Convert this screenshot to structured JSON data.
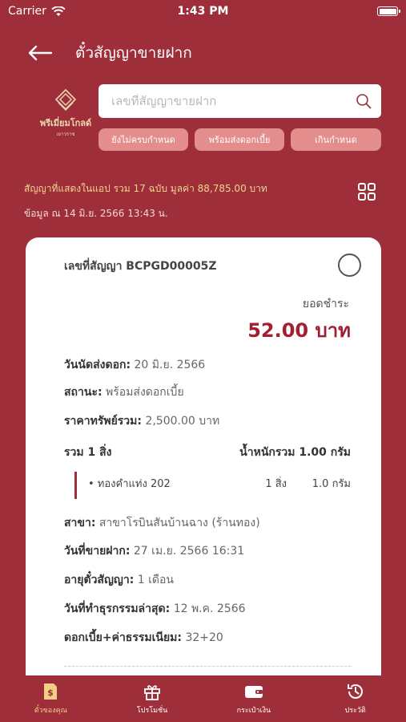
{
  "status_bar": {
    "carrier": "Carrier",
    "time": "1:43 PM"
  },
  "nav": {
    "title": "ตั๋วสัญญาขายฝาก"
  },
  "logo": {
    "name": "พรีเมี่ยมโกลด์",
    "sub": "เยาวราช"
  },
  "search": {
    "placeholder": "เลขที่สัญญาขายฝาก",
    "value": ""
  },
  "filters": [
    "ยังไม่ครบกำหนด",
    "พร้อมส่งดอกเบี้ย",
    "เกินกำหนด"
  ],
  "summary": {
    "text": "สัญญาที่แสดงในแอป รวม 17 ฉบับ มูลค่า 88,785.00 บาท",
    "updated": "ข้อมูล ณ 14 มิ.ย. 2566 13:43  น."
  },
  "card": {
    "contract_no": "เลขที่สัญญา BCPGD00005Z",
    "amount_label": "ยอดชำระ",
    "amount": "52.00 บาท",
    "due_label": "วันนัดส่งดอก:",
    "due_value": "20 มิ.ย. 2566",
    "status_label": "สถานะ:",
    "status_value": "พร้อมส่งดอกเบี้ย",
    "asset_label": "ราคาทรัพย์รวม:",
    "asset_value": "2,500.00 บาท",
    "items_total": "รวม 1 สิ่ง",
    "weight_total": "น้ำหนักรวม 1.00 กรัม",
    "items": [
      {
        "name": "• ทองคำแท่ง 202",
        "qty": "1 สิ่ง",
        "weight": "1.0 กรัม"
      }
    ],
    "branch_label": "สาขา:",
    "branch_value": "สาขาโรบินสันบ้านฉาง (ร้านทอง)",
    "sold_label": "วันที่ขายฝาก:",
    "sold_value": "27 เม.ย. 2566 16:31",
    "term_label": "อายุตั๋วสัญญา:",
    "term_value": "1 เดือน",
    "last_txn_label": "วันที่ทำธุรกรรมล่าสุด:",
    "last_txn_value": "12 พ.ค. 2566",
    "fee_label": "ดอกเบี้ย+ค่าธรรมเนียม:",
    "fee_value": "32+20"
  },
  "tabs": [
    {
      "label": "ตั๋วของคุณ",
      "icon": "ticket-icon",
      "active": true
    },
    {
      "label": "โปรโมชั่น",
      "icon": "gift-icon",
      "active": false
    },
    {
      "label": "กระเป๋าเงิน",
      "icon": "wallet-icon",
      "active": false
    },
    {
      "label": "ประวัติ",
      "icon": "history-icon",
      "active": false
    }
  ],
  "colors": {
    "primary": "#9e2f3a",
    "chip": "#e38d8d",
    "gold": "#f2d58c",
    "amount": "#a21f31"
  }
}
